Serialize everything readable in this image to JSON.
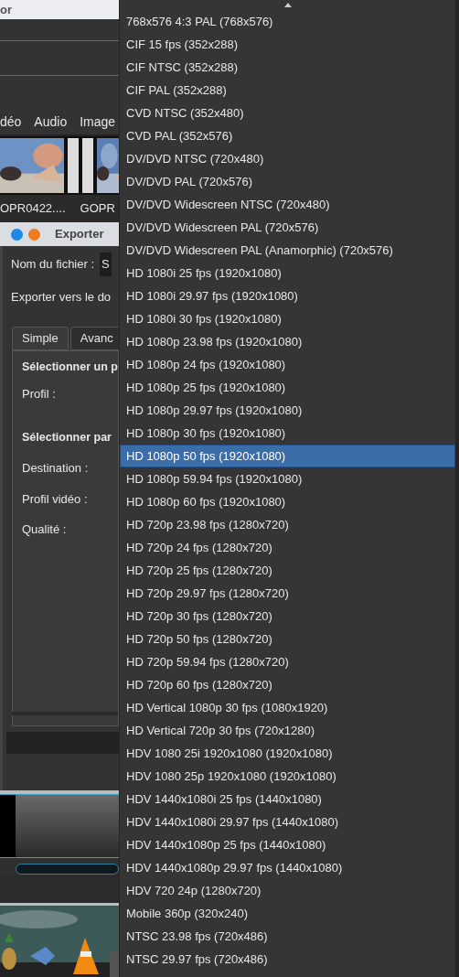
{
  "background_window": {
    "title": "or",
    "tabs": [
      "déo",
      "Audio",
      "Image"
    ],
    "clips": [
      "OPR0422....",
      "GOPR"
    ]
  },
  "export_dialog": {
    "title": "Exporter",
    "filename_label": "Nom du fichier :",
    "filename_value": "S",
    "folder_label": "Exporter vers le do",
    "tabs": [
      {
        "label": "Simple",
        "selected": true
      },
      {
        "label": "Avanc",
        "selected": false
      }
    ],
    "section_profile": "Sélectionner un p",
    "profile_label": "Profil :",
    "section_params": "Sélectionner par",
    "fields": [
      "Destination :",
      "Profil vidéo :",
      "Qualité :"
    ]
  },
  "menu": {
    "items": [
      {
        "label": "768x576 4:3 PAL (768x576)",
        "selected": false
      },
      {
        "label": "CIF 15 fps (352x288)",
        "selected": false
      },
      {
        "label": "CIF NTSC (352x288)",
        "selected": false
      },
      {
        "label": "CIF PAL (352x288)",
        "selected": false
      },
      {
        "label": "CVD NTSC (352x480)",
        "selected": false
      },
      {
        "label": "CVD PAL (352x576)",
        "selected": false
      },
      {
        "label": "DV/DVD NTSC (720x480)",
        "selected": false
      },
      {
        "label": "DV/DVD PAL (720x576)",
        "selected": false
      },
      {
        "label": "DV/DVD Widescreen NTSC (720x480)",
        "selected": false
      },
      {
        "label": "DV/DVD Widescreen PAL (720x576)",
        "selected": false
      },
      {
        "label": "DV/DVD Widescreen PAL (Anamorphic) (720x576)",
        "selected": false
      },
      {
        "label": "HD 1080i 25 fps (1920x1080)",
        "selected": false
      },
      {
        "label": "HD 1080i 29.97 fps (1920x1080)",
        "selected": false
      },
      {
        "label": "HD 1080i 30 fps (1920x1080)",
        "selected": false
      },
      {
        "label": "HD 1080p 23.98 fps (1920x1080)",
        "selected": false
      },
      {
        "label": "HD 1080p 24 fps (1920x1080)",
        "selected": false
      },
      {
        "label": "HD 1080p 25 fps (1920x1080)",
        "selected": false
      },
      {
        "label": "HD 1080p 29.97 fps (1920x1080)",
        "selected": false
      },
      {
        "label": "HD 1080p 30 fps (1920x1080)",
        "selected": false
      },
      {
        "label": "HD 1080p 50 fps (1920x1080)",
        "selected": true
      },
      {
        "label": "HD 1080p 59.94 fps (1920x1080)",
        "selected": false
      },
      {
        "label": "HD 1080p 60 fps (1920x1080)",
        "selected": false
      },
      {
        "label": "HD 720p 23.98 fps (1280x720)",
        "selected": false
      },
      {
        "label": "HD 720p 24 fps (1280x720)",
        "selected": false
      },
      {
        "label": "HD 720p 25 fps (1280x720)",
        "selected": false
      },
      {
        "label": "HD 720p 29.97 fps (1280x720)",
        "selected": false
      },
      {
        "label": "HD 720p 30 fps (1280x720)",
        "selected": false
      },
      {
        "label": "HD 720p 50 fps (1280x720)",
        "selected": false
      },
      {
        "label": "HD 720p 59.94 fps (1280x720)",
        "selected": false
      },
      {
        "label": "HD 720p 60 fps (1280x720)",
        "selected": false
      },
      {
        "label": "HD Vertical 1080p 30 fps (1080x1920)",
        "selected": false
      },
      {
        "label": "HD Vertical 720p 30 fps (720x1280)",
        "selected": false
      },
      {
        "label": "HDV 1080 25i 1920x1080 (1920x1080)",
        "selected": false
      },
      {
        "label": "HDV 1080 25p 1920x1080 (1920x1080)",
        "selected": false
      },
      {
        "label": "HDV 1440x1080i 25 fps (1440x1080)",
        "selected": false
      },
      {
        "label": "HDV 1440x1080i 29.97 fps (1440x1080)",
        "selected": false
      },
      {
        "label": "HDV 1440x1080p 25 fps (1440x1080)",
        "selected": false
      },
      {
        "label": "HDV 1440x1080p 29.97 fps (1440x1080)",
        "selected": false
      },
      {
        "label": "HDV 720 24p (1280x720)",
        "selected": false
      },
      {
        "label": "Mobile 360p (320x240)",
        "selected": false
      },
      {
        "label": "NTSC 23.98 fps (720x486)",
        "selected": false
      },
      {
        "label": "NTSC 29.97 fps (720x486)",
        "selected": false
      }
    ]
  }
}
